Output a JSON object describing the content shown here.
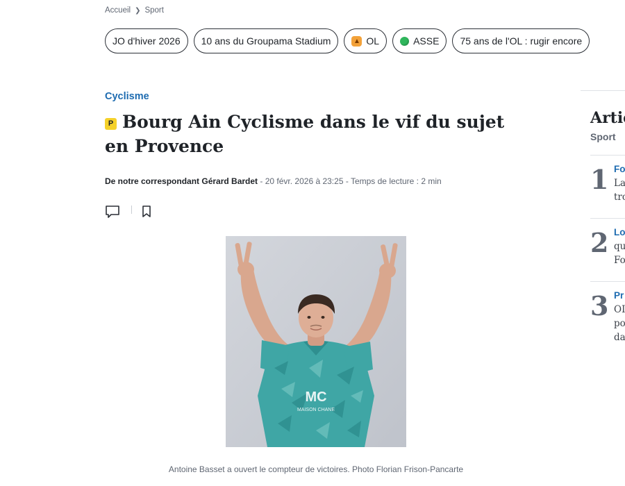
{
  "breadcrumb": {
    "home": "Accueil",
    "current": "Sport"
  },
  "topics": [
    {
      "label": "JO d'hiver 2026",
      "icon": ""
    },
    {
      "label": "10 ans du Groupama Stadium",
      "icon": ""
    },
    {
      "label": "OL",
      "icon": "lion-emoji-icon"
    },
    {
      "label": "ASSE",
      "icon": "green-circle-icon"
    },
    {
      "label": "75 ans de l'OL : rugir encore",
      "icon": ""
    }
  ],
  "article": {
    "section": "Cyclisme",
    "premium_badge": "P",
    "title": "Bourg Ain Cyclisme dans le vif du sujet en Provence",
    "author": "De notre correspondant Gérard Bardet",
    "date": "20 févr. 2026 à 23:25",
    "reading_time": "Temps de lecture : 2 min",
    "separator": " - ",
    "photo_caption": "Antoine Basset a ouvert le compteur de victoires. Photo Florian Frison-Pancarte"
  },
  "sidebar": {
    "title": "Artic",
    "subtitle": "Sport",
    "items": [
      {
        "num": "1",
        "lines": [
          "Fo",
          "La",
          "tro"
        ]
      },
      {
        "num": "2",
        "lines": [
          "Lo",
          "qu",
          "Fo"
        ]
      },
      {
        "num": "3",
        "lines": [
          "Pr",
          "OI",
          "po",
          "da"
        ]
      }
    ]
  },
  "colors": {
    "accent": "#1d6bb0",
    "premium": "#f5d12a",
    "jersey": "#3fa6a5",
    "background_photo": "#c7cbd3"
  }
}
